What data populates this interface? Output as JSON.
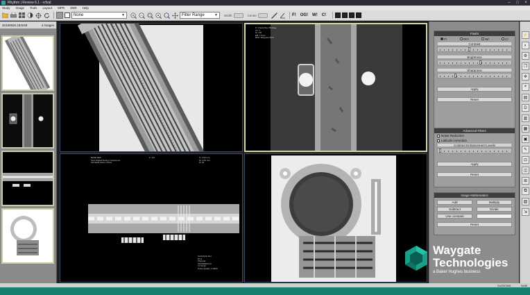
{
  "window": {
    "title": "Rhythm | Review 6.1 - rcfval",
    "controls": [
      "–",
      "□",
      "×"
    ]
  },
  "menu": [
    "Study",
    "Image",
    "Tools",
    "Layout",
    "MPR",
    "SNR",
    "Help"
  ],
  "toolbar": {
    "display_mode": "None",
    "filter": "Filter Range",
    "width_label": "Width",
    "center_label": "Center",
    "flag_buttons": [
      "F!",
      "OG!",
      "W!",
      "C!"
    ]
  },
  "study": {
    "name": "20190825.183248",
    "image_count": "4 images"
  },
  "viewports": {
    "xray2_overlay": "P: Check Rtg: 85.0deg\nXT: 4\nM: 145\nEB: 7.5mm\nBAS: Waygate Tech.",
    "xray3_overlay_left": "BASE DEC\nTech Digital/Testing Conference\nS/Z Weld Shine Check",
    "xray3_overlay_top": "F: 4.8",
    "xray3_overlay_right": "S: 1.00 mm\nM: 1.00 mm\nR: 15",
    "xray3_overlay_bottom": "Tech/Optic Rel\nM: 8\nPhotonic\n20170804/3ms\n17:53:42\nPulse Quality: 0.0000"
  },
  "panel": {
    "flash": {
      "title": "Flash!",
      "radios": [
        "F!",
        "OG!",
        "W!",
        "C!"
      ],
      "selected": "F!",
      "contrast": "Contrast",
      "brightness": "Brightness",
      "sharpness": "Sharpness",
      "contrast_level": 0.42,
      "brightness_level": 0.58,
      "sharpness_level": 0.22,
      "apply": "Apply",
      "reset": "Reset"
    },
    "advanced": {
      "title": "Advanced Filters",
      "noise_reduction": "Noise Reduction",
      "latitude_correction": "Latitude correction",
      "levels_label": "Contrast Enhancement Levels",
      "levels_value": 0.0,
      "apply": "Apply",
      "reset": "Reset"
    },
    "math": {
      "title": "Image Mathematics",
      "add": "Add",
      "multiply": "Multiply",
      "subtract": "Subtract",
      "divide": "Divide",
      "use_constant": "Use constant",
      "reset": "Reset"
    }
  },
  "status": {
    "value": "2x2007661",
    "zoom": "NUM"
  },
  "brand": {
    "line1": "Waygate",
    "line2": "Technologies",
    "tagline": "a Baker Hughes business",
    "color": "#17806f"
  }
}
